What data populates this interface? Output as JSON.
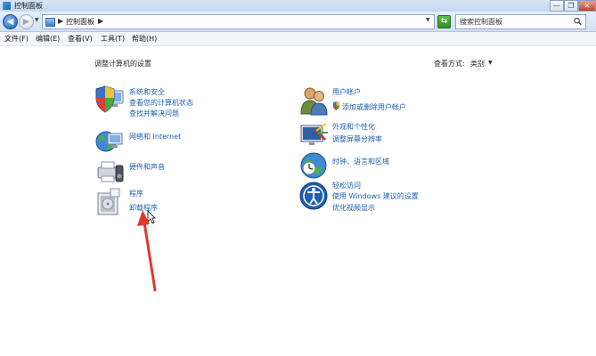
{
  "window": {
    "title": "控制面板",
    "controls": [
      "—",
      "❐",
      "✕"
    ]
  },
  "address": {
    "location": "控制面板",
    "separator": "▶"
  },
  "search": {
    "placeholder": "搜索控制面板"
  },
  "menu": [
    "文件(F)",
    "编辑(E)",
    "查看(V)",
    "工具(T)",
    "帮助(H)"
  ],
  "content": {
    "title": "调整计算机的设置",
    "view_by_label": "查看方式:",
    "view_by_value": "类别"
  },
  "categories_left": [
    {
      "icon": "shield-computer-icon",
      "title": "系统和安全",
      "links": [
        "查看您的计算机状态",
        "查找并解决问题"
      ]
    },
    {
      "icon": "network-globe-icon",
      "title": "网络和 Internet",
      "links": []
    },
    {
      "icon": "printer-speaker-icon",
      "title": "硬件和声音",
      "links": []
    },
    {
      "icon": "programs-box-icon",
      "title": "程序",
      "links": [
        "卸载程序"
      ]
    }
  ],
  "categories_right": [
    {
      "icon": "users-icon",
      "title": "用户帐户",
      "links": [
        "添加或删除用户帐户"
      ]
    },
    {
      "icon": "display-paint-icon",
      "title": "外观和个性化",
      "links": [
        "调整屏幕分辨率"
      ]
    },
    {
      "icon": "clock-globe-icon",
      "title": "时钟、语言和区域",
      "links": []
    },
    {
      "icon": "ease-of-access-icon",
      "title": "轻松访问",
      "links": [
        "使用 Windows 建议的设置",
        "优化视频显示"
      ]
    }
  ],
  "colors": {
    "link": "#1d5fb0",
    "annotation_arrow": "#e0372e"
  }
}
